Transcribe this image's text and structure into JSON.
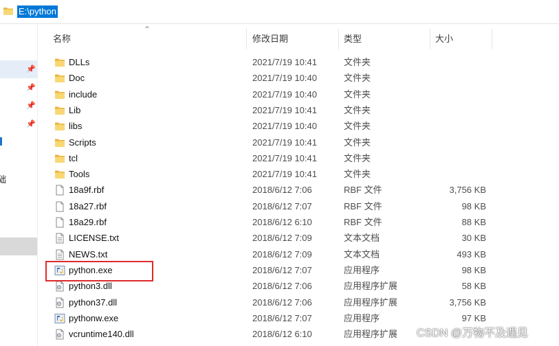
{
  "address": {
    "path": "E:\\python"
  },
  "columns": {
    "name": "名称",
    "date": "修改日期",
    "type": "类型",
    "size": "大小"
  },
  "nav": {
    "pins": [
      "📌",
      "📌",
      "📌",
      "📌"
    ],
    "fragment_char": "础"
  },
  "files": [
    {
      "name": "DLLs",
      "date": "2021/7/19 10:41",
      "type": "文件夹",
      "size": "",
      "icon": "folder-icon"
    },
    {
      "name": "Doc",
      "date": "2021/7/19 10:40",
      "type": "文件夹",
      "size": "",
      "icon": "folder-icon"
    },
    {
      "name": "include",
      "date": "2021/7/19 10:40",
      "type": "文件夹",
      "size": "",
      "icon": "folder-icon"
    },
    {
      "name": "Lib",
      "date": "2021/7/19 10:41",
      "type": "文件夹",
      "size": "",
      "icon": "folder-icon"
    },
    {
      "name": "libs",
      "date": "2021/7/19 10:40",
      "type": "文件夹",
      "size": "",
      "icon": "folder-icon"
    },
    {
      "name": "Scripts",
      "date": "2021/7/19 10:41",
      "type": "文件夹",
      "size": "",
      "icon": "folder-icon"
    },
    {
      "name": "tcl",
      "date": "2021/7/19 10:41",
      "type": "文件夹",
      "size": "",
      "icon": "folder-icon"
    },
    {
      "name": "Tools",
      "date": "2021/7/19 10:41",
      "type": "文件夹",
      "size": "",
      "icon": "folder-icon"
    },
    {
      "name": "18a9f.rbf",
      "date": "2018/6/12 7:06",
      "type": "RBF 文件",
      "size": "3,756 KB",
      "icon": "file-icon"
    },
    {
      "name": "18a27.rbf",
      "date": "2018/6/12 7:07",
      "type": "RBF 文件",
      "size": "98 KB",
      "icon": "file-icon"
    },
    {
      "name": "18a29.rbf",
      "date": "2018/6/12 6:10",
      "type": "RBF 文件",
      "size": "88 KB",
      "icon": "file-icon"
    },
    {
      "name": "LICENSE.txt",
      "date": "2018/6/12 7:09",
      "type": "文本文档",
      "size": "30 KB",
      "icon": "text-file-icon"
    },
    {
      "name": "NEWS.txt",
      "date": "2018/6/12 7:09",
      "type": "文本文档",
      "size": "493 KB",
      "icon": "text-file-icon"
    },
    {
      "name": "python.exe",
      "date": "2018/6/12 7:07",
      "type": "应用程序",
      "size": "98 KB",
      "icon": "python-exe-icon"
    },
    {
      "name": "python3.dll",
      "date": "2018/6/12 7:06",
      "type": "应用程序扩展",
      "size": "58 KB",
      "icon": "dll-icon"
    },
    {
      "name": "python37.dll",
      "date": "2018/6/12 7:06",
      "type": "应用程序扩展",
      "size": "3,756 KB",
      "icon": "dll-icon"
    },
    {
      "name": "pythonw.exe",
      "date": "2018/6/12 7:07",
      "type": "应用程序",
      "size": "97 KB",
      "icon": "python-exe-icon"
    },
    {
      "name": "vcruntime140.dll",
      "date": "2018/6/12 6:10",
      "type": "应用程序扩展",
      "size": "",
      "icon": "dll-icon"
    }
  ],
  "watermark": "CSDN @万物不及遇见",
  "colors": {
    "selection": "#0078d7",
    "highlight_box": "#e0292b",
    "folder": "#f8d775"
  }
}
